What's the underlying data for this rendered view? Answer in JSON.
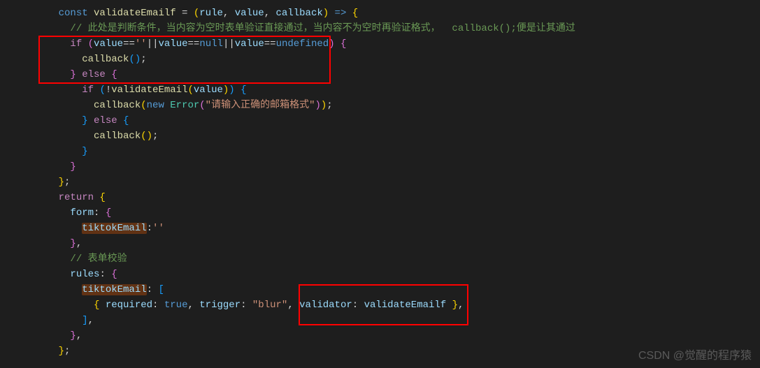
{
  "lines": {
    "l1": {
      "const": "const ",
      "name": "validateEmailf",
      "eq": " = ",
      "paren_open": "(",
      "p1": "rule",
      "comma1": ", ",
      "p2": "value",
      "comma2": ", ",
      "p3": "callback",
      "paren_close": ")",
      "arrow": " => ",
      "brace": "{"
    },
    "l2": {
      "comment": "// 此处是判断条件，当内容为空时表单验证直接通过，当内容不为空时再验证格式，  callback();便是让其通过"
    },
    "l3": {
      "if": "if ",
      "po": "(",
      "v1": "value",
      "op1": "==",
      "s1": "''",
      "or1": "||",
      "v2": "value",
      "op2": "==",
      "null": "null",
      "or2": "||",
      "v3": "value",
      "op3": "==",
      "undef": "undefined",
      "pc": ")",
      "brace": " {"
    },
    "l4": {
      "fn": "callback",
      "po": "(",
      "pc": ")",
      "semi": ";"
    },
    "l5": {
      "brace": "}",
      "else": " else ",
      "brace2": "{"
    },
    "l6": {
      "if": "if ",
      "po": "(",
      "not": "!",
      "fn": "validateEmail",
      "po2": "(",
      "v": "value",
      "pc2": ")",
      "pc": ")",
      "brace": " {"
    },
    "l7": {
      "fn": "callback",
      "po": "(",
      "new": "new ",
      "err": "Error",
      "po2": "(",
      "str": "\"请输入正确的邮箱格式\"",
      "pc2": ")",
      "pc": ")",
      "semi": ";"
    },
    "l8": {
      "brace": "}",
      "else": " else ",
      "brace2": "{"
    },
    "l9": {
      "fn": "callback",
      "po": "(",
      "pc": ")",
      "semi": ";"
    },
    "l10": {
      "brace": "}"
    },
    "l11": {
      "brace": "}"
    },
    "l12": {
      "brace": "}",
      "semi": ";"
    },
    "l13": {
      "return": "return ",
      "brace": "{"
    },
    "l14": {
      "prop": "form",
      "colon": ": ",
      "brace": "{"
    },
    "l15": {
      "prop": "tiktokEmail",
      "colon": ":",
      "str": "''"
    },
    "l16": {
      "brace": "}",
      "comma": ","
    },
    "l17": {
      "comment": "// 表单校验"
    },
    "l18": {
      "prop": "rules",
      "colon": ": ",
      "brace": "{"
    },
    "l19": {
      "prop": "tiktokEmail",
      "colon": ": ",
      "bracket": "["
    },
    "l20": {
      "brace": "{",
      "p1": " required",
      "c1": ": ",
      "v1": "true",
      "comma1": ", ",
      "p2": "trigger",
      "c2": ": ",
      "v2": "\"blur\"",
      "comma2": ", ",
      "p3": "validator",
      "c3": ": ",
      "v3": "validateEmailf",
      "brace2": " }",
      "comma3": ","
    },
    "l21": {
      "bracket": "]",
      "comma": ","
    },
    "l22": {
      "brace": "}",
      "comma": ","
    },
    "l23": {
      "brace": "}",
      "semi": ";"
    }
  },
  "watermark": "CSDN @觉醒的程序猿"
}
